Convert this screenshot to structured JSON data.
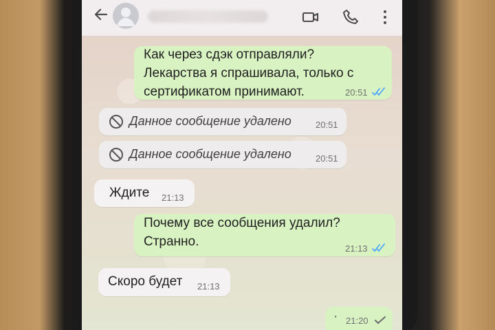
{
  "header": {
    "back_icon": "arrow-left-icon",
    "avatar": "default-avatar-icon",
    "actions": [
      "video-call-icon",
      "phone-icon",
      "more-vertical-icon"
    ]
  },
  "messages": [
    {
      "text": "Как через сдэк отправляли?\nЛекарства я спрашивала, только с\nсертификатом принимают.",
      "time": "20:51",
      "direction": "outgoing",
      "status": "read"
    },
    {
      "text": "Данное сообщение удалено",
      "time": "20:51",
      "direction": "incoming",
      "status": "deleted"
    },
    {
      "text": "Данное сообщение удалено",
      "time": "20:51",
      "direction": "incoming",
      "status": "deleted"
    },
    {
      "text": "Ждите",
      "time": "21:13",
      "direction": "incoming"
    },
    {
      "text": "Почему все сообщения удалил?\nСтранно.",
      "time": "21:13",
      "direction": "outgoing",
      "status": "read"
    },
    {
      "text": "Скоро будет",
      "time": "21:13",
      "direction": "incoming"
    },
    {
      "text": "·",
      "time": "21:20",
      "direction": "outgoing",
      "status": "delivered"
    }
  ],
  "colors": {
    "outgoing_bubble": "#d8f2c2",
    "incoming_bubble": "#f5f2f3",
    "read_tick": "#4fa7ff",
    "delivered_tick": "#6a6a6a"
  }
}
